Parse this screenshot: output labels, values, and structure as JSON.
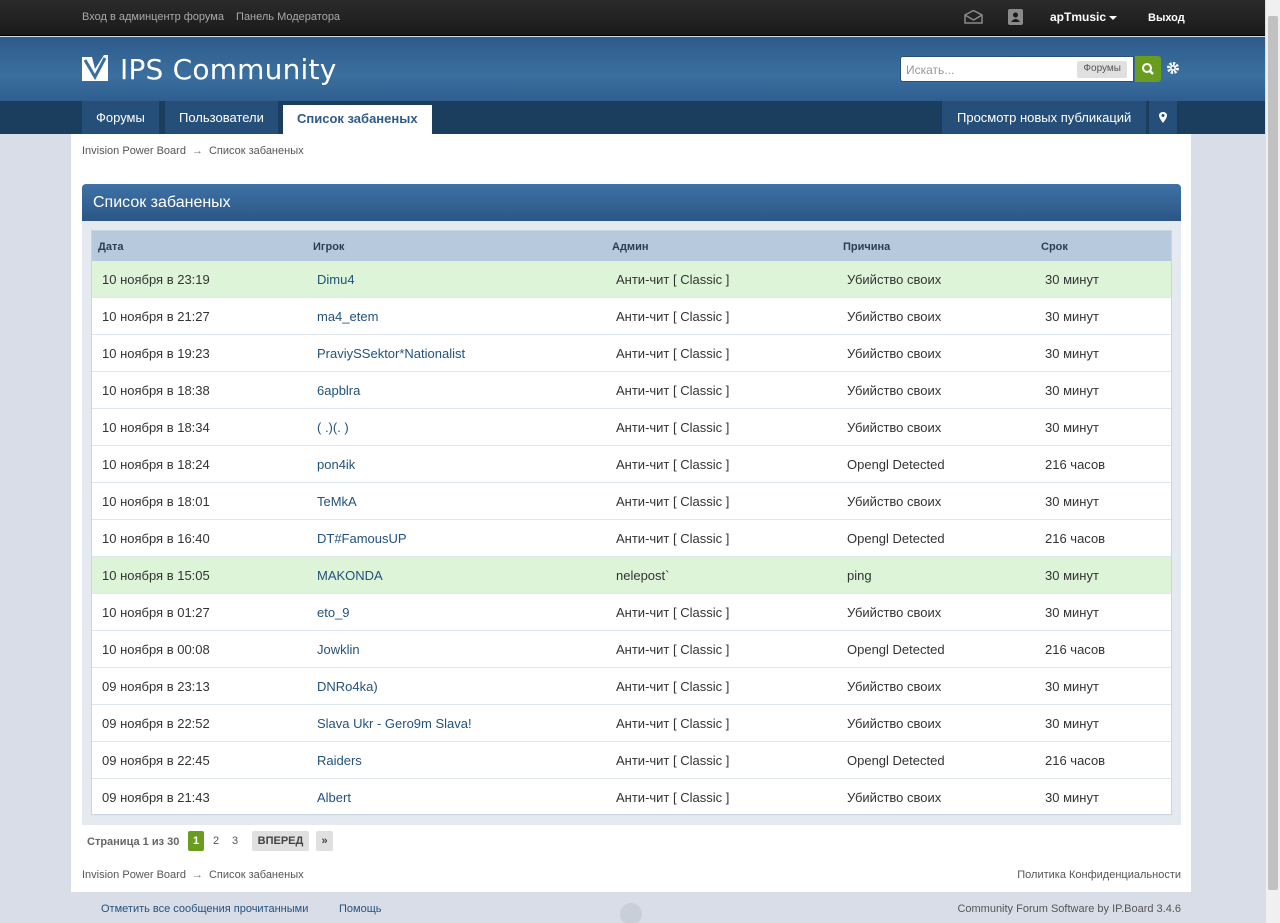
{
  "userbar": {
    "links": [
      "Вход в админцентр форума",
      "Панель Модератора"
    ],
    "username": "apTmusic",
    "logout": "Выход",
    "icons": [
      "mail-icon",
      "notification-icon"
    ]
  },
  "branding": {
    "title": "IPS Community",
    "search_placeholder": "Искать...",
    "search_scope": "Форумы"
  },
  "nav": {
    "tabs": [
      {
        "label": "Форумы",
        "active": false
      },
      {
        "label": "Пользователи",
        "active": false
      },
      {
        "label": "Список забаненых",
        "active": true
      }
    ],
    "new_posts": "Просмотр новых публикаций"
  },
  "breadcrumb": {
    "root": "Invision Power Board",
    "current": "Список забаненых",
    "arrow": "→"
  },
  "panel_title": "Список забаненых",
  "table": {
    "headers": [
      "Дата",
      "Игрок",
      "Админ",
      "Причина",
      "Срок"
    ],
    "rows": [
      {
        "date": "10 ноября в 23:19",
        "player": "Dimu4",
        "admin": "Анти-чит [ Classic ]",
        "reason": "Убийство своих",
        "term": "30 минут",
        "highlight": true
      },
      {
        "date": "10 ноября в 21:27",
        "player": "ma4_etem",
        "admin": "Анти-чит [ Classic ]",
        "reason": "Убийство своих",
        "term": "30 минут",
        "highlight": false
      },
      {
        "date": "10 ноября в 19:23",
        "player": "PraviySSektor*Nationalist",
        "admin": "Анти-чит [ Classic ]",
        "reason": "Убийство своих",
        "term": "30 минут",
        "highlight": false
      },
      {
        "date": "10 ноября в 18:38",
        "player": "6apblra",
        "admin": "Анти-чит [ Classic ]",
        "reason": "Убийство своих",
        "term": "30 минут",
        "highlight": false
      },
      {
        "date": "10 ноября в 18:34",
        "player": "( .)(. )",
        "admin": "Анти-чит [ Classic ]",
        "reason": "Убийство своих",
        "term": "30 минут",
        "highlight": false
      },
      {
        "date": "10 ноября в 18:24",
        "player": "pon4ik",
        "admin": "Анти-чит [ Classic ]",
        "reason": "Opengl Detected",
        "term": "216 часов",
        "highlight": false
      },
      {
        "date": "10 ноября в 18:01",
        "player": "TeMkA",
        "admin": "Анти-чит [ Classic ]",
        "reason": "Убийство своих",
        "term": "30 минут",
        "highlight": false
      },
      {
        "date": "10 ноября в 16:40",
        "player": "DT#FamousUP",
        "admin": "Анти-чит [ Classic ]",
        "reason": "Opengl Detected",
        "term": "216 часов",
        "highlight": false
      },
      {
        "date": "10 ноября в 15:05",
        "player": "MAKONDA",
        "admin": "nelepost`",
        "reason": "ping",
        "term": "30 минут",
        "highlight": true
      },
      {
        "date": "10 ноября в 01:27",
        "player": "eto_9",
        "admin": "Анти-чит [ Classic ]",
        "reason": "Убийство своих",
        "term": "30 минут",
        "highlight": false
      },
      {
        "date": "10 ноября в 00:08",
        "player": "Jowklin",
        "admin": "Анти-чит [ Classic ]",
        "reason": "Opengl Detected",
        "term": "216 часов",
        "highlight": false
      },
      {
        "date": "09 ноября в 23:13",
        "player": "DNRo4ka)",
        "admin": "Анти-чит [ Classic ]",
        "reason": "Убийство своих",
        "term": "30 минут",
        "highlight": false
      },
      {
        "date": "09 ноября в 22:52",
        "player": "Slava Ukr - Gero9m Slava!",
        "admin": "Анти-чит [ Classic ]",
        "reason": "Убийство своих",
        "term": "30 минут",
        "highlight": false
      },
      {
        "date": "09 ноября в 22:45",
        "player": "Raiders",
        "admin": "Анти-чит [ Classic ]",
        "reason": "Opengl Detected",
        "term": "216 часов",
        "highlight": false
      },
      {
        "date": "09 ноября в 21:43",
        "player": "Albert",
        "admin": "Анти-чит [ Classic ]",
        "reason": "Убийство своих",
        "term": "30 минут",
        "highlight": false
      }
    ]
  },
  "pagination": {
    "label": "Страница 1 из 30",
    "current": "1",
    "pages": [
      "2",
      "3"
    ],
    "next": "ВПЕРЕД",
    "last": "»"
  },
  "privacy": "Политика Конфиденциальности",
  "footer": {
    "mark_read": "Отметить все сообщения прочитанными",
    "help": "Помощь",
    "copyright": "Community Forum Software by IP.Board 3.4.6"
  },
  "colors": {
    "brand": "#3b6f9f",
    "nav": "#1b3d5e",
    "highlight_row": "#ddf4d9",
    "accent_green": "#6a9d1f",
    "link": "#23527c"
  }
}
